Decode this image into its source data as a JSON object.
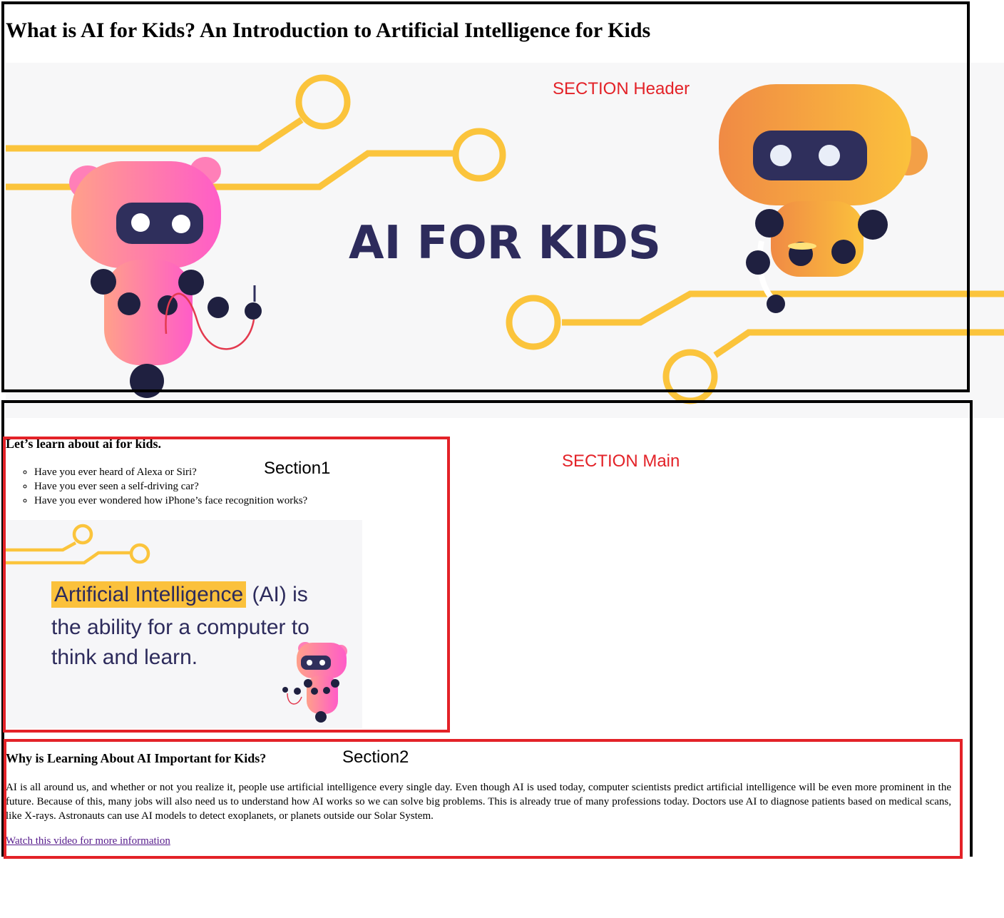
{
  "page": {
    "title": "What is AI for Kids? An Introduction to Artificial Intelligence for Kids"
  },
  "header_section": {
    "annotation_label": "SECTION Header",
    "banner": {
      "text": "AI FOR KIDS",
      "text_color": "#2d2b5c",
      "background_color": "#f7f7f8",
      "circuit_color": "#fbc43c"
    }
  },
  "main_section": {
    "annotation_label": "SECTION Main",
    "section1": {
      "annotation_label": "Section1",
      "heading": "Let’s learn about ai for kids.",
      "questions": [
        "Have you ever heard of Alexa or Siri?",
        "Have you ever seen a self-driving car?",
        "Have you ever wondered how iPhone’s face recognition works?"
      ],
      "info_card": {
        "highlight_text": "Artificial Intelligence",
        "line1_rest": " (AI) is",
        "line2": "the ability for a computer to",
        "line3": "think and learn.",
        "highlight_color": "#fbc13c"
      }
    },
    "section2": {
      "annotation_label": "Section2",
      "heading": "Why is Learning About AI Important for Kids?",
      "paragraph": "AI is all around us, and whether or not you realize it, people use artificial intelligence every single day. Even though AI is used today, computer scientists predict artificial intelligence will be even more prominent in the future. Because of this, many jobs will also need us to understand how AI works so we can solve big problems. This is already true of many professions today. Doctors use AI to diagnose patients based on medical scans, like X-rays. Astronauts can use AI models to detect exoplanets, or planets outside our Solar System.",
      "link_text": "Watch this video for more information"
    }
  },
  "annotation_colors": {
    "section_outline": "#000000",
    "subsection_outline": "#e32228",
    "label_red": "#e32228"
  }
}
